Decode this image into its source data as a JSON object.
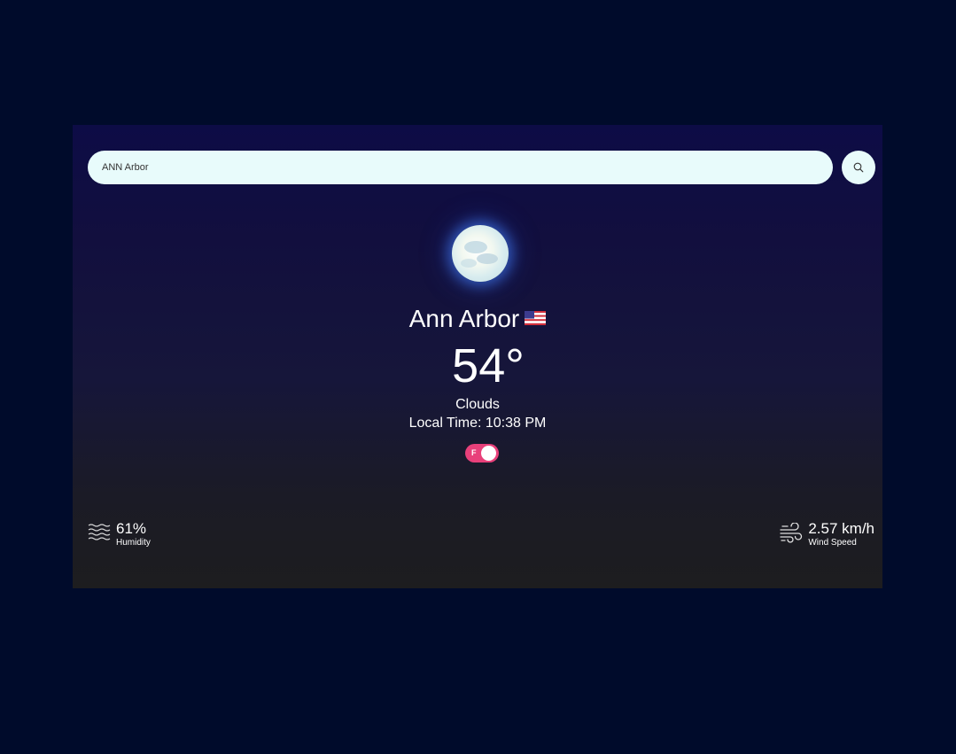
{
  "search": {
    "value": "ANN Arbor",
    "button_icon": "search-icon"
  },
  "weather": {
    "icon": "moon-clouds-icon",
    "city": "Ann Arbor",
    "country_flag": "us-flag-icon",
    "temperature": "54°",
    "condition": "Clouds",
    "local_time": "Local Time: 10:38 PM"
  },
  "unit_toggle": {
    "label": "F",
    "on": true,
    "color": "#e8407a"
  },
  "stats": {
    "humidity": {
      "value": "61%",
      "label": "Humidity",
      "icon": "waves-icon"
    },
    "wind": {
      "value": "2.57 km/h",
      "label": "Wind Speed",
      "icon": "wind-icon"
    }
  }
}
